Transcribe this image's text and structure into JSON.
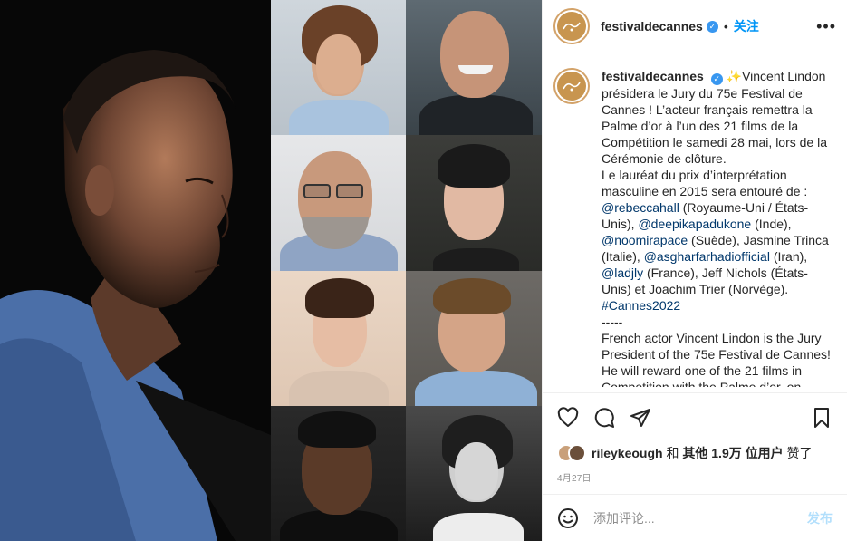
{
  "header": {
    "username": "festivaldecannes",
    "dot": "•",
    "follow_label": "关注",
    "more_label": "•••",
    "avatar_text": "Cannes"
  },
  "caption": {
    "username": "festivaldecannes",
    "emoji": "✨",
    "p1": "Vincent Lindon présidera le Jury du 75e Festival de Cannes ! L’acteur français remettra la Palme d’or à l’un des 21 films de la Compétition le samedi 28 mai, lors de la Cérémonie de clôture.",
    "p2_start": "Le lauréat du prix d’interprétation masculine en 2015 sera entouré de : ",
    "m1": "@rebeccahall",
    "t1": " (Royaume-Uni / États-Unis), ",
    "m2": "@deepikapadukone",
    "t2": " (Inde), ",
    "m3": "@noomirapace",
    "t3": " (Suède), Jasmine Trinca (Italie), ",
    "m4": "@asgharfarhadiofficial",
    "t4": " (Iran), ",
    "m5": "@ladjly",
    "t5": " (France), Jeff Nichols (États-Unis) et Joachim Trier (Norvège). ",
    "m6": "#Cannes2022",
    "sep": "-----",
    "p3": "French actor Vincent Lindon is the Jury President of the 75e Festival de Cannes! He will reward one of the 21 films in Competition with the Palme d’or, on"
  },
  "likes": {
    "user": "rileykeough",
    "and": "和",
    "others": "其他 1.9万 位用户",
    "liked": "赞了"
  },
  "date": "4月27日",
  "comment": {
    "placeholder": "添加评论...",
    "post_label": "发布"
  },
  "colors": {
    "accent": "#0095f6",
    "mention": "#00376b",
    "post_disabled": "#b2dffc",
    "verified": "#3897f0"
  },
  "icons": [
    "heart-icon",
    "comment-icon",
    "share-icon",
    "bookmark-icon",
    "emoji-icon",
    "verified-icon",
    "more-icon"
  ]
}
